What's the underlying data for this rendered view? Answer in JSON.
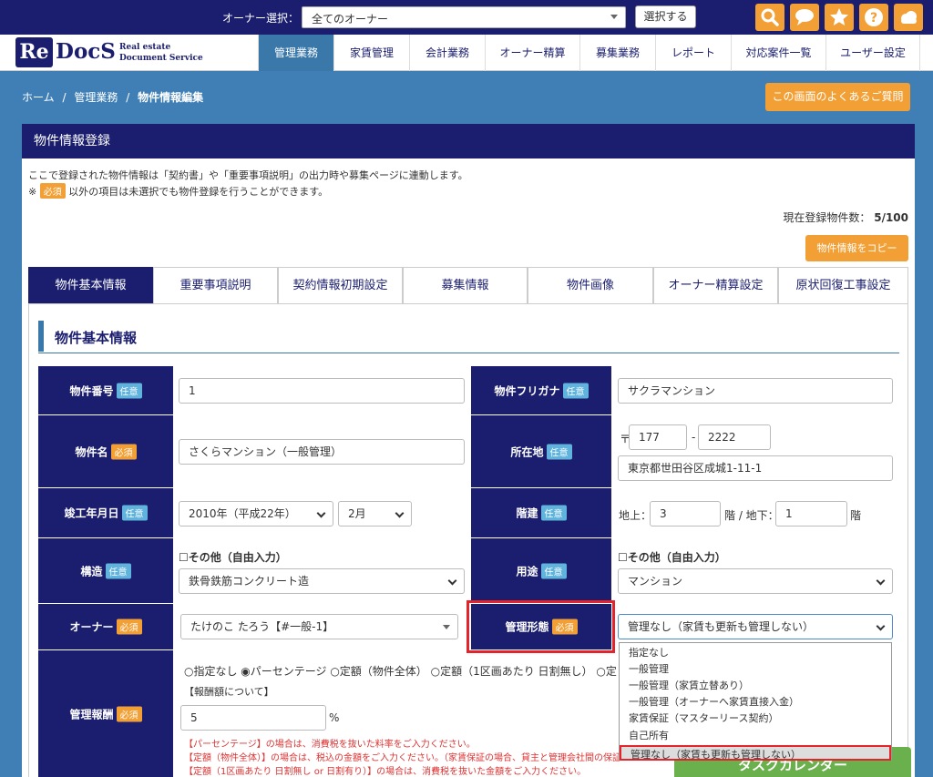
{
  "topbar": {
    "owner_label": "オーナー選択：",
    "owner_value": "全てのオーナー",
    "select_button": "選択する",
    "icons": [
      "search-icon",
      "chat-icon",
      "star-icon",
      "help-icon",
      "cloud-icon"
    ],
    "icon_color": "#f2a035"
  },
  "logo": {
    "re": "Re",
    "docs": "DocS",
    "line1": "Real estate",
    "line2": "Document Service"
  },
  "nav": [
    "管理業務",
    "家賃管理",
    "会計業務",
    "オーナー精算",
    "募集業務",
    "レポート",
    "対応案件一覧",
    "ユーザー設定"
  ],
  "breadcrumb": {
    "home": "ホーム",
    "sep": "/",
    "level1": "管理業務",
    "current": "物件情報編集"
  },
  "faq_button": "この画面のよくあるご質問",
  "panel": {
    "title": "物件情報登録",
    "intro1": "ここで登録された物件情報は「契約書」や「重要事項説明」の出力時や募集ページに連動します。",
    "intro2_prefix": "※",
    "intro2_suffix": "以外の項目は未選択でも物件登録を行うことができます。",
    "count_label": "現在登録物件数：",
    "count_value": "5/100",
    "copy_button": "物件情報をコピー"
  },
  "badges": {
    "required": "必須",
    "optional": "任意"
  },
  "tabs": [
    "物件基本情報",
    "重要事項説明",
    "契約情報初期設定",
    "募集情報",
    "物件画像",
    "オーナー精算設定",
    "原状回復工事設定"
  ],
  "section_title": "物件基本情報",
  "form": {
    "bukken_no": {
      "label": "物件番号",
      "value": "1"
    },
    "furigana": {
      "label": "物件フリガナ",
      "value": "サクラマンション"
    },
    "name": {
      "label": "物件名",
      "value": "さくらマンション（一般管理）"
    },
    "address": {
      "label": "所在地",
      "zip_mark": "〒",
      "zip1": "177",
      "zip_sep": "-",
      "zip2": "2222",
      "value": "東京都世田谷区成城1-11-1"
    },
    "built": {
      "label": "竣工年月日",
      "year": "2010年（平成22年）",
      "month": "2月"
    },
    "floors": {
      "label": "階建",
      "above_label": "地上：",
      "above": "3",
      "mid": "階 / 地下：",
      "below": "1",
      "suffix": "階"
    },
    "structure": {
      "label": "構造",
      "check": "☐その他（自由入力）",
      "value": "鉄骨鉄筋コンクリート造"
    },
    "usage": {
      "label": "用途",
      "check": "☐その他（自由入力）",
      "value": "マンション"
    },
    "owner": {
      "label": "オーナー",
      "value": "たけのこ たろう【#一般-1】"
    },
    "mgmt_type": {
      "label": "管理形態",
      "value": "管理なし（家賃も更新も管理しない）"
    },
    "fee": {
      "label": "管理報酬",
      "radios": "○指定なし ◉パーセンテージ ○定額（物件全体） ○定額（1区画あたり 日割無し） ○定",
      "about": "【報酬額について】",
      "value": "5",
      "unit": "%",
      "note1": "【パーセンテージ】の場合は、消費税を抜いた料率をご入力ください。",
      "note2": "【定額（物件全体）】の場合は、税込の金額をご入力ください。（家賃保証の場合、貸主と管理会社間の保証",
      "note3": "【定額（1区画あたり 日割無し or 日割有り）】の場合は、消費税を抜いた金額をご入力ください。"
    }
  },
  "dropdown_options": [
    "指定なし",
    "一般管理",
    "一般管理（家賃立替あり）",
    "一般管理（オーナーへ家賃直接入金）",
    "家賃保証（マスターリース契約）",
    "自己所有",
    "管理なし（家賃も更新も管理しない）"
  ],
  "green_button": "タスクカレンダー"
}
